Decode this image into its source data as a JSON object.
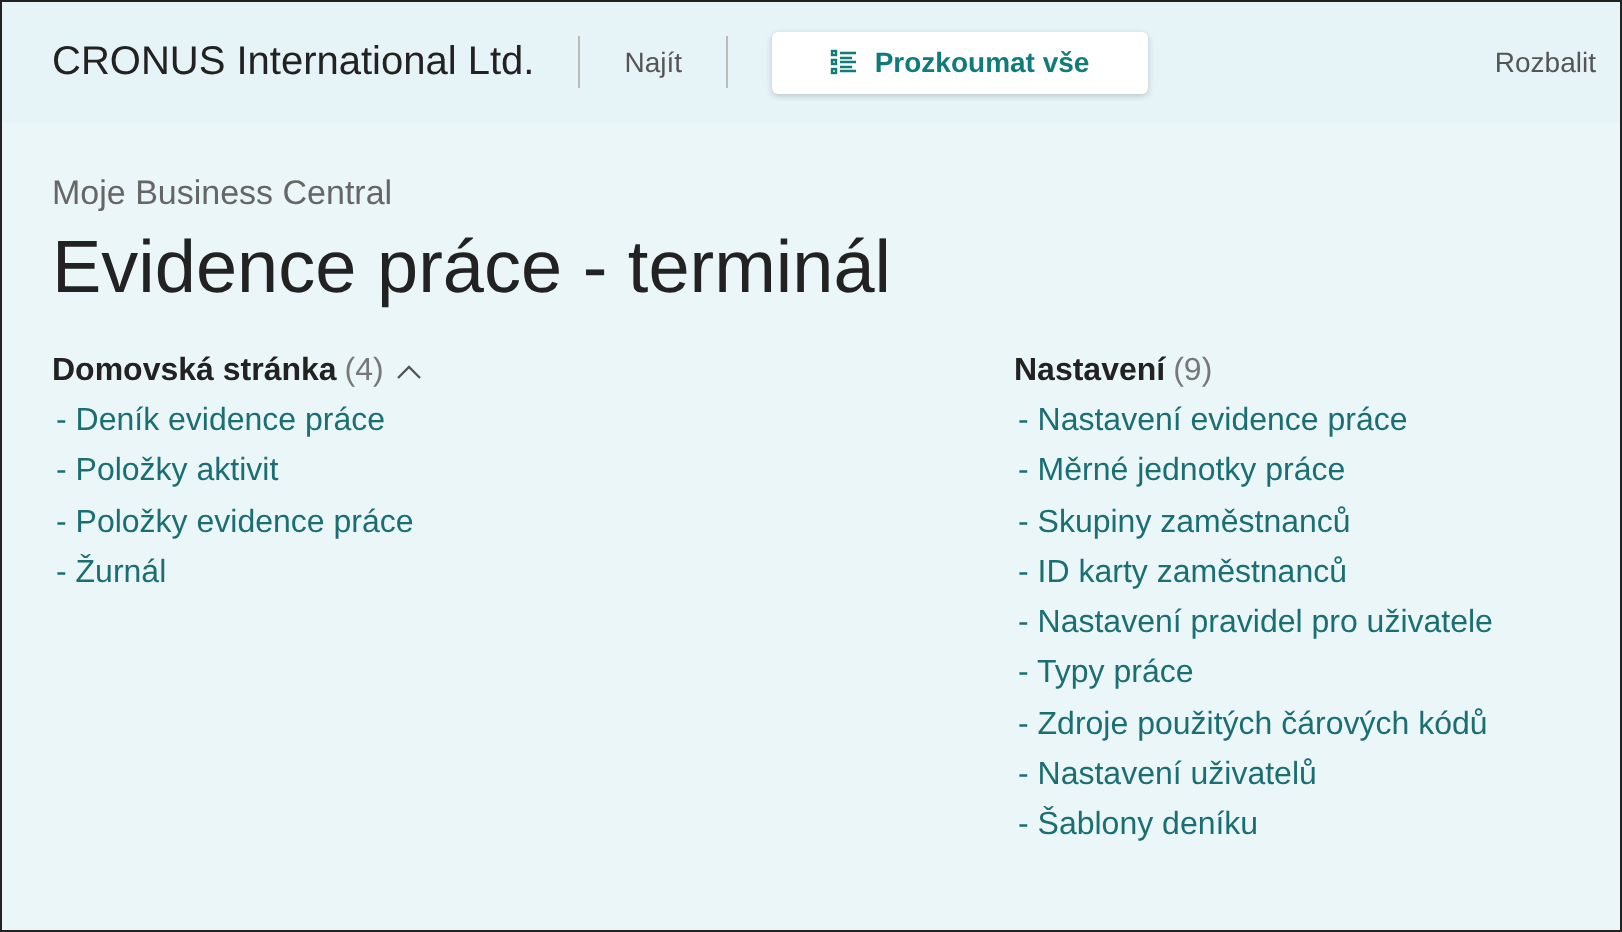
{
  "top_bar": {
    "company": "CRONUS International Ltd.",
    "find": "Najít",
    "explore": "Prozkoumat vše",
    "expand": "Rozbalit"
  },
  "breadcrumb": "Moje Business Central",
  "title": "Evidence práce - terminál",
  "groups": [
    {
      "title": "Domovská stránka",
      "count": "(4)",
      "expanded": true,
      "links": [
        "- Deník evidence práce",
        "- Položky aktivit",
        "- Položky evidence práce",
        "- Žurnál"
      ]
    },
    {
      "title": "Nastavení",
      "count": "(9)",
      "links": [
        "- Nastavení evidence práce",
        "- Měrné jednotky práce",
        "- Skupiny zaměstnanců",
        "- ID karty zaměstnanců",
        "- Nastavení pravidel pro uživatele",
        "- Typy práce",
        "- Zdroje použitých čárových kódů",
        "- Nastavení uživatelů",
        "- Šablony deníku"
      ]
    }
  ]
}
